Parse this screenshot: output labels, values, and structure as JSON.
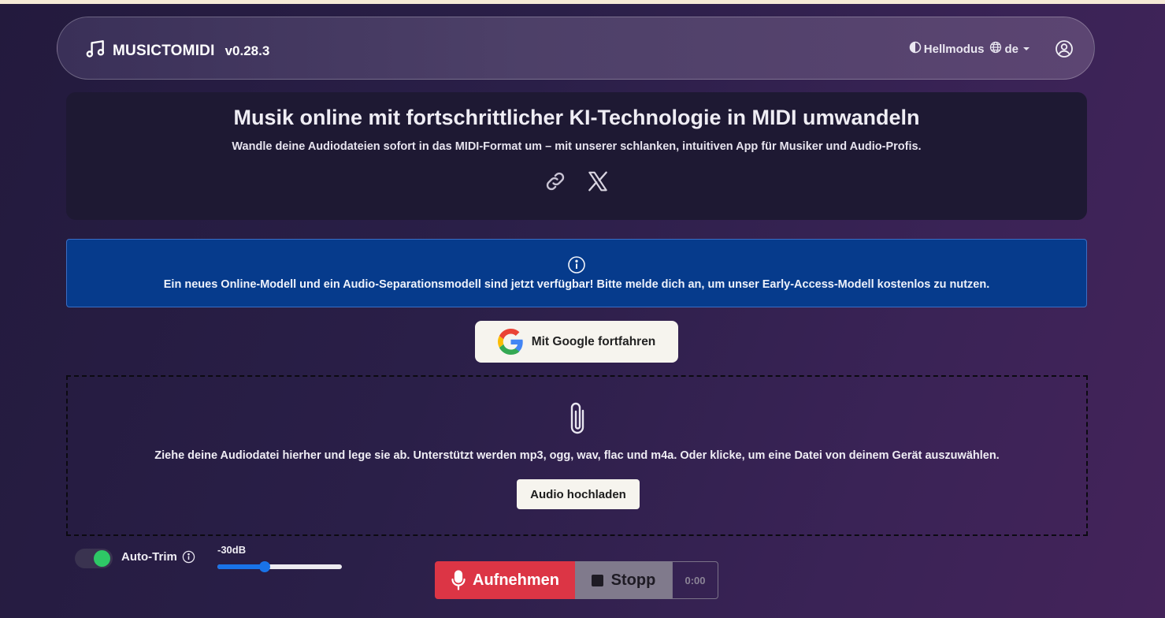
{
  "navbar": {
    "brand_name": "MUSICTOMIDI",
    "brand_version": "v0.28.3",
    "theme_label": "Hellmodus",
    "language_label": "de"
  },
  "hero": {
    "title": "Musik online mit fortschrittlicher KI-Technologie in MIDI umwandeln",
    "subtitle": "Wandle deine Audiodateien sofort in das MIDI-Format um – mit unserer schlanken, intuitiven App für Musiker und Audio-Profis."
  },
  "info": {
    "text": "Ein neues Online-Modell und ein Audio-Separationsmodell sind jetzt verfügbar! Bitte melde dich an, um unser Early-Access-Modell kostenlos zu nutzen."
  },
  "google_button": {
    "label": "Mit Google fortfahren"
  },
  "dropzone": {
    "text": "Ziehe deine Audiodatei hierher und lege sie ab. Unterstützt werden mp3, ogg, wav, flac und m4a. Oder klicke, um eine Datei von deinem Gerät auszuwählen.",
    "upload_label": "Audio hochladen"
  },
  "controls": {
    "auto_trim_label": "Auto-Trim",
    "auto_trim_on": true,
    "threshold_label": "-30dB",
    "threshold_fraction": 0.38,
    "record_label": "Aufnehmen",
    "stop_label": "Stopp",
    "timer": "0:00"
  },
  "colors": {
    "record": "#dc3545",
    "info_bg": "#063b8c",
    "toggle_on": "#2ec866",
    "slider": "#1973e8"
  }
}
